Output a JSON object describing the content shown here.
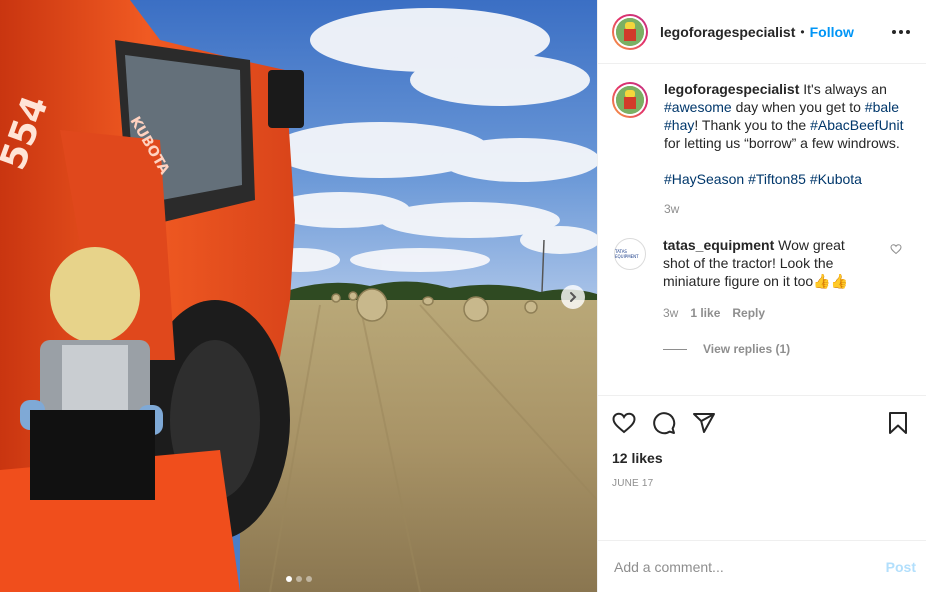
{
  "post": {
    "username": "legoforagespecialist",
    "separator": "•",
    "follow_label": "Follow",
    "more_icon": "more-options-icon"
  },
  "caption": {
    "username": "legoforagespecialist",
    "parts": [
      {
        "text": " It's always an ",
        "tag": false
      },
      {
        "text": "#awesome",
        "tag": true
      },
      {
        "text": " day when you get to ",
        "tag": false
      },
      {
        "text": "#bale",
        "tag": true
      },
      {
        "text": " ",
        "tag": false
      },
      {
        "text": "#hay",
        "tag": true
      },
      {
        "text": "! Thank you to the ",
        "tag": false
      },
      {
        "text": "#AbacBeefUnit",
        "tag": true
      },
      {
        "text": " for letting us “borrow” a few windrows.",
        "tag": false
      }
    ],
    "hashtags": [
      "#HaySeason",
      "#Tifton85",
      "#Kubota"
    ],
    "time": "3w"
  },
  "comment": {
    "username": "tatas_equipment",
    "text": " Wow great shot of the tractor! Look the miniature figure on it too👍👍",
    "avatar_text": "TATAS EQUIPMENT",
    "time": "3w",
    "likes": "1 like",
    "reply_label": "Reply",
    "heart_icon": "heart-outline-icon",
    "view_replies": "View replies (1)"
  },
  "actions": {
    "icons": [
      "heart-icon",
      "comment-icon",
      "share-icon",
      "bookmark-icon"
    ],
    "likes": "12 likes",
    "date": "JUNE 17"
  },
  "add_comment": {
    "placeholder": "Add a comment...",
    "post_label": "Post"
  },
  "carousel": {
    "slide_count": 3,
    "active_index": 0,
    "next_icon": "chevron-right-icon"
  },
  "photo": {
    "tractor_model_text": "554",
    "tractor_brand_text": "KUBOTA"
  },
  "colors": {
    "accent": "#0095f6",
    "hashtag": "#00376b",
    "muted": "#8e8e8e",
    "post_disabled": "#b2dffc",
    "tractor_orange": "#f0501f"
  }
}
